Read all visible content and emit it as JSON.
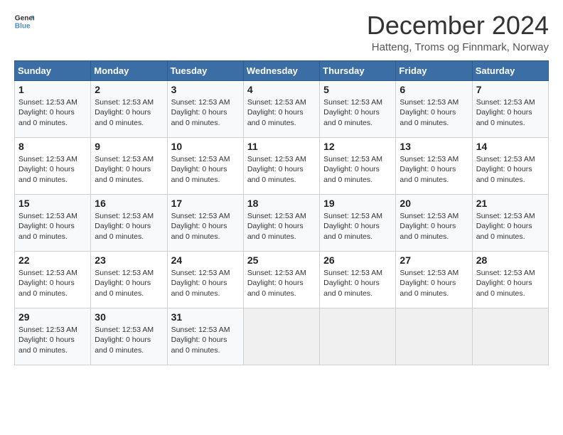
{
  "logo": {
    "line1": "General",
    "line2": "Blue"
  },
  "title": "December 2024",
  "location": "Hatteng, Troms og Finnmark, Norway",
  "days_of_week": [
    "Sunday",
    "Monday",
    "Tuesday",
    "Wednesday",
    "Thursday",
    "Friday",
    "Saturday"
  ],
  "day_info": {
    "sunset": "Sunset: 12:53 AM",
    "daylight": "Daylight: 0 hours and 0 minutes."
  },
  "weeks": [
    [
      {
        "day": "1",
        "info": true
      },
      {
        "day": "2",
        "info": true
      },
      {
        "day": "3",
        "info": true
      },
      {
        "day": "4",
        "info": true
      },
      {
        "day": "5",
        "info": true
      },
      {
        "day": "6",
        "info": true
      },
      {
        "day": "7",
        "info": true
      }
    ],
    [
      {
        "day": "8",
        "info": true
      },
      {
        "day": "9",
        "info": true
      },
      {
        "day": "10",
        "info": true
      },
      {
        "day": "11",
        "info": true
      },
      {
        "day": "12",
        "info": true
      },
      {
        "day": "13",
        "info": true
      },
      {
        "day": "14",
        "info": true
      }
    ],
    [
      {
        "day": "15",
        "info": true
      },
      {
        "day": "16",
        "info": true
      },
      {
        "day": "17",
        "info": true
      },
      {
        "day": "18",
        "info": true
      },
      {
        "day": "19",
        "info": true
      },
      {
        "day": "20",
        "info": true
      },
      {
        "day": "21",
        "info": true
      }
    ],
    [
      {
        "day": "22",
        "info": true
      },
      {
        "day": "23",
        "info": true
      },
      {
        "day": "24",
        "info": true
      },
      {
        "day": "25",
        "info": true
      },
      {
        "day": "26",
        "info": true
      },
      {
        "day": "27",
        "info": true
      },
      {
        "day": "28",
        "info": true
      }
    ],
    [
      {
        "day": "29",
        "info": true
      },
      {
        "day": "30",
        "info": true
      },
      {
        "day": "31",
        "info": true
      },
      {
        "day": "",
        "info": false
      },
      {
        "day": "",
        "info": false
      },
      {
        "day": "",
        "info": false
      },
      {
        "day": "",
        "info": false
      }
    ]
  ]
}
